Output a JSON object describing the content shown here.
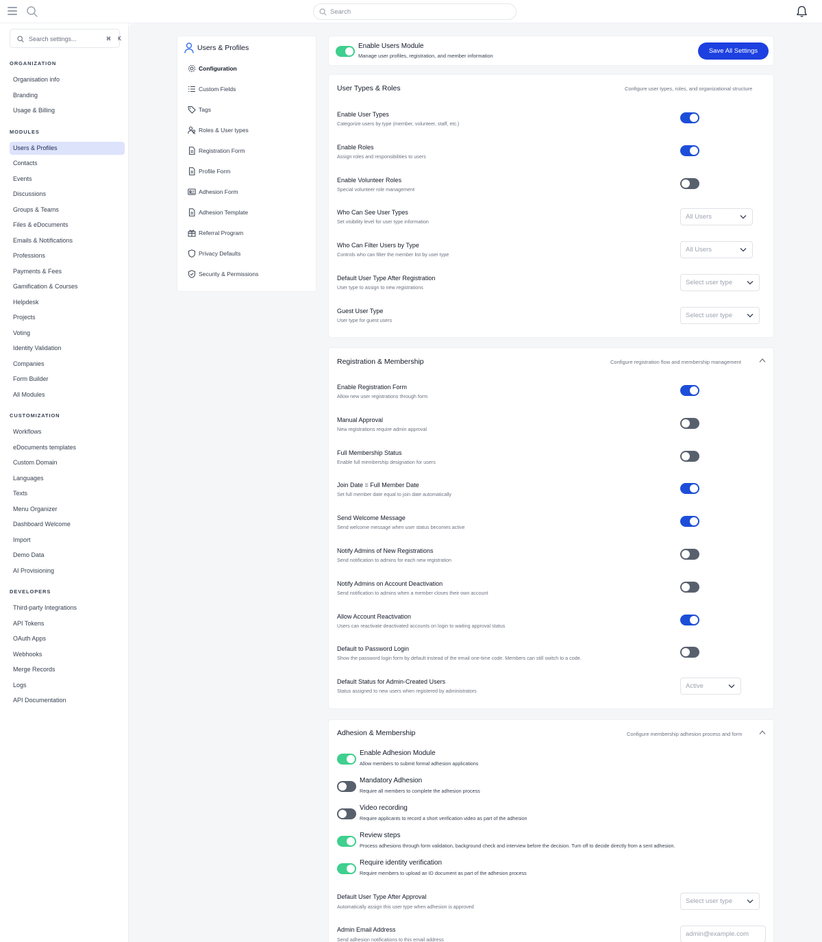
{
  "topbar": {
    "search_placeholder": "Search"
  },
  "sidebar": {
    "search_placeholder": "Search settings...",
    "shortcut_key1": "⌘",
    "shortcut_key2": "K",
    "sections": [
      {
        "title": "ORGANIZATION",
        "items": [
          "Organisation info",
          "Branding",
          "Usage & Billing"
        ]
      },
      {
        "title": "MODULES",
        "items": [
          "Users & Profiles",
          "Contacts",
          "Events",
          "Discussions",
          "Groups & Teams",
          "Files & eDocuments",
          "Emails & Notifications",
          "Professions",
          "Payments & Fees",
          "Gamification & Courses",
          "Helpdesk",
          "Projects",
          "Voting",
          "Identity Validation",
          "Companies",
          "Form Builder",
          "All Modules"
        ]
      },
      {
        "title": "CUSTOMIZATION",
        "items": [
          "Workflows",
          "eDocuments templates",
          "Custom Domain",
          "Languages",
          "Texts",
          "Menu Organizer",
          "Dashboard Welcome",
          "Import",
          "Demo Data",
          "AI Provisioning"
        ]
      },
      {
        "title": "DEVELOPERS",
        "items": [
          "Third-party Integrations",
          "API Tokens",
          "OAuth Apps",
          "Webhooks",
          "Merge Records",
          "Logs",
          "API Documentation"
        ]
      }
    ],
    "active_item": "Users & Profiles"
  },
  "subnav": {
    "title": "Users & Profiles",
    "items": [
      {
        "label": "Configuration",
        "icon": "gear-icon",
        "active": true
      },
      {
        "label": "Custom Fields",
        "icon": "list-icon",
        "active": false
      },
      {
        "label": "Tags",
        "icon": "tag-icon",
        "active": false
      },
      {
        "label": "Roles & User types",
        "icon": "users-icon",
        "active": false
      },
      {
        "label": "Registration Form",
        "icon": "document-icon",
        "active": false
      },
      {
        "label": "Profile Form",
        "icon": "document-icon",
        "active": false
      },
      {
        "label": "Adhesion Form",
        "icon": "id-card-icon",
        "active": false
      },
      {
        "label": "Adhesion Template",
        "icon": "document-icon",
        "active": false
      },
      {
        "label": "Referral Program",
        "icon": "gift-icon",
        "active": false
      },
      {
        "label": "Privacy Defaults",
        "icon": "shield-icon",
        "active": false
      },
      {
        "label": "Security & Permissions",
        "icon": "shield-check-icon",
        "active": false
      }
    ]
  },
  "module": {
    "title": "Enable Users Module",
    "description": "Manage user profiles, registration, and member information",
    "enabled": true,
    "save_label": "Save All Settings"
  },
  "user_types": {
    "title": "User Types & Roles",
    "description": "Configure user types, roles, and organizational structure",
    "rows": [
      {
        "title": "Enable User Types",
        "desc": "Categorize users by type (member, volunteer, staff, etc.)",
        "control": "toggle",
        "on": true
      },
      {
        "title": "Enable Roles",
        "desc": "Assign roles and responsibilities to users",
        "control": "toggle",
        "on": true
      },
      {
        "title": "Enable Volunteer Roles",
        "desc": "Special volunteer role management",
        "control": "toggle",
        "on": false
      },
      {
        "title": "Who Can See User Types",
        "desc": "Set visibility level for user type information",
        "control": "select",
        "value": "All Users"
      },
      {
        "title": "Who Can Filter Users by Type",
        "desc": "Controls who can filter the member list by user type",
        "control": "select",
        "value": "All Users"
      },
      {
        "title": "Default User Type After Registration",
        "desc": "User type to assign to new registrations",
        "control": "select",
        "value": "Select user type"
      },
      {
        "title": "Guest User Type",
        "desc": "User type for guest users",
        "control": "select",
        "value": "Select user type"
      }
    ]
  },
  "registration": {
    "title": "Registration & Membership",
    "description": "Configure registration flow and membership management",
    "rows": [
      {
        "title": "Enable Registration Form",
        "desc": "Allow new user registrations through form",
        "control": "toggle",
        "on": true
      },
      {
        "title": "Manual Approval",
        "desc": "New registrations require admin approval",
        "control": "toggle",
        "on": false
      },
      {
        "title": "Full Membership Status",
        "desc": "Enable full membership designation for users",
        "control": "toggle",
        "on": false
      },
      {
        "title": "Join Date = Full Member Date",
        "desc": "Set full member date equal to join date automatically",
        "control": "toggle",
        "on": true
      },
      {
        "title": "Send Welcome Message",
        "desc": "Send welcome message when user status becomes active",
        "control": "toggle",
        "on": true
      },
      {
        "title": "Notify Admins of New Registrations",
        "desc": "Send notification to admins for each new registration",
        "control": "toggle",
        "on": false
      },
      {
        "title": "Notify Admins on Account Deactivation",
        "desc": "Send notification to admins when a member closes their own account",
        "control": "toggle",
        "on": false
      },
      {
        "title": "Allow Account Reactivation",
        "desc": "Users can reactivate deactivated accounts on login to waiting approval status",
        "control": "toggle",
        "on": true
      },
      {
        "title": "Default to Password Login",
        "desc": "Show the password login form by default instead of the email one-time code. Members can still switch to a code.",
        "control": "toggle",
        "on": false
      },
      {
        "title": "Default Status for Admin-Created Users",
        "desc": "Status assigned to new users when registered by administrators",
        "control": "select",
        "value": "Active"
      }
    ]
  },
  "adhesion": {
    "title": "Adhesion & Membership",
    "description": "Configure membership adhesion process and form",
    "toggles": [
      {
        "title": "Enable Adhesion Module",
        "desc": "Allow members to submit formal adhesion applications",
        "on": true
      },
      {
        "title": "Mandatory Adhesion",
        "desc": "Require all members to complete the adhesion process",
        "on": false
      },
      {
        "title": "Video recording",
        "desc": "Require applicants to record a short verification video as part of the adhesion",
        "on": false
      },
      {
        "title": "Review steps",
        "desc": "Process adhesions through form validation, background check and interview before the decision. Turn off to decide directly from a sent adhesion.",
        "on": true
      },
      {
        "title": "Require identity verification",
        "desc": "Require members to upload an ID document as part of the adhesion process",
        "on": true
      }
    ],
    "default_type": {
      "title": "Default User Type After Approval",
      "desc": "Automatically assign this user type when adhesion is approved",
      "value": "Select user type"
    },
    "admin_email": {
      "title": "Admin Email Address",
      "desc": "Send adhesion notifications to this email address",
      "placeholder": "admin@example.com"
    }
  },
  "colors": {
    "primary": "#1d40e0",
    "toggle_on": "#1d4ed8",
    "toggle_green": "#3fcf8e",
    "toggle_off": "#59606d",
    "active_nav_bg": "#dde3fb"
  }
}
